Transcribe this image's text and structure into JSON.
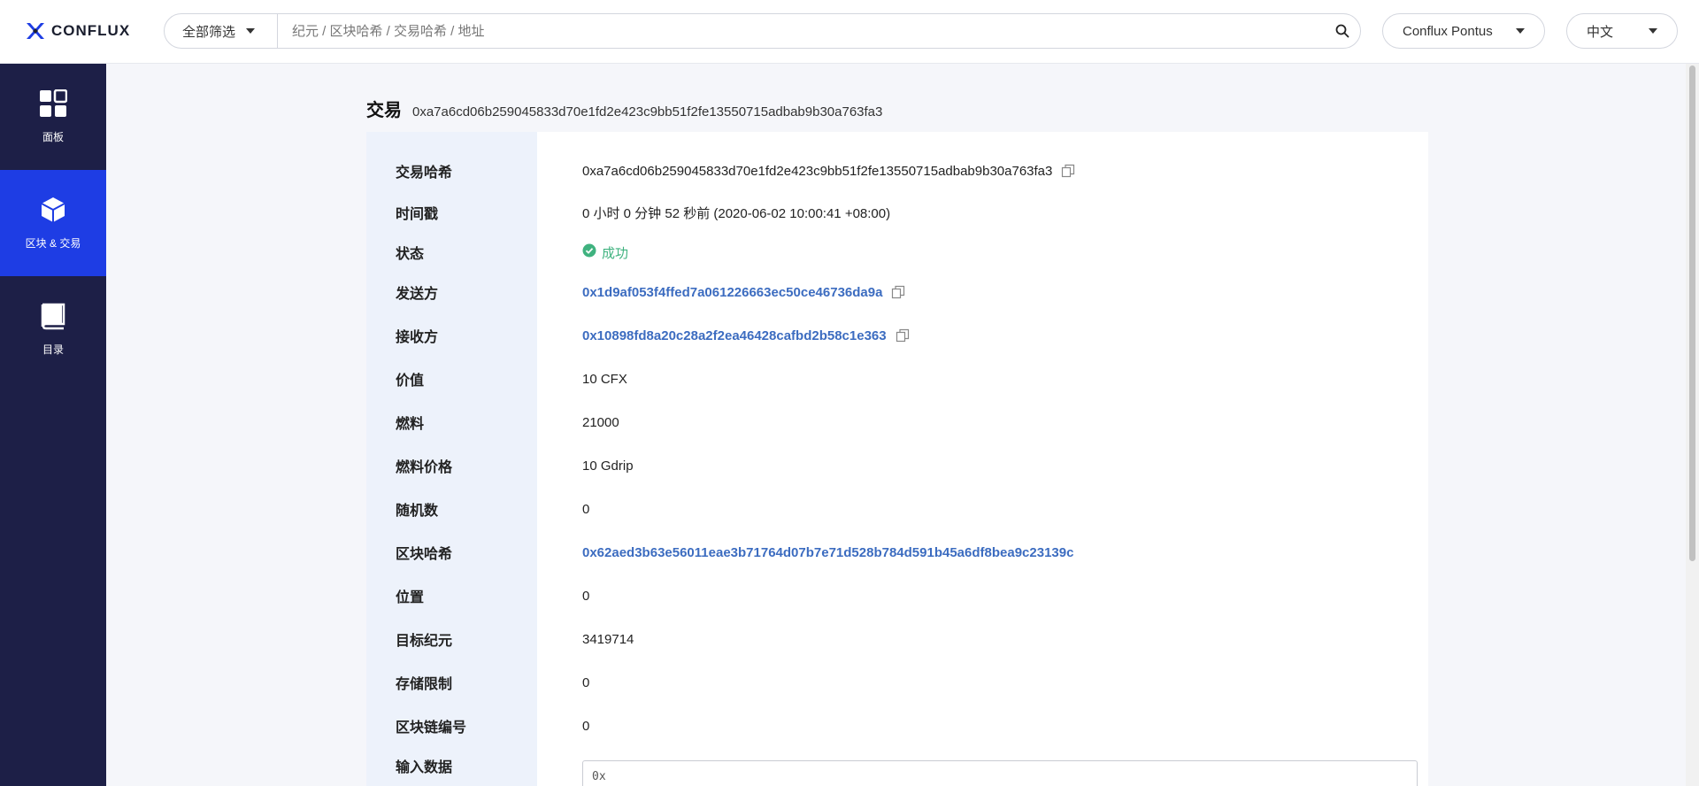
{
  "header": {
    "logo_text": "CONFLUX",
    "filter_label": "全部筛选",
    "search_placeholder": "纪元 / 区块哈希 / 交易哈希 / 地址",
    "network_label": "Conflux Pontus",
    "language_label": "中文"
  },
  "sidebar": {
    "items": [
      {
        "label": "面板",
        "icon": "dashboard-icon",
        "active": false
      },
      {
        "label": "区块 & 交易",
        "icon": "cube-icon",
        "active": true
      },
      {
        "label": "目录",
        "icon": "book-icon",
        "active": false
      }
    ]
  },
  "page": {
    "title": "交易",
    "hash": "0xa7a6cd06b259045833d70e1fd2e423c9bb51f2fe13550715adbab9b30a763fa3"
  },
  "details": {
    "tx_hash_label": "交易哈希",
    "tx_hash_value": "0xa7a6cd06b259045833d70e1fd2e423c9bb51f2fe13550715adbab9b30a763fa3",
    "timestamp_label": "时间戳",
    "timestamp_value": "0 小时 0 分钟 52 秒前  (2020-06-02 10:00:41 +08:00)",
    "status_label": "状态",
    "status_value": "成功",
    "from_label": "发送方",
    "from_value": "0x1d9af053f4ffed7a061226663ec50ce46736da9a",
    "to_label": "接收方",
    "to_value": "0x10898fd8a20c28a2f2ea46428cafbd2b58c1e363",
    "value_label": "价值",
    "value_value": "10 CFX",
    "gas_label": "燃料",
    "gas_value": "21000",
    "gas_price_label": "燃料价格",
    "gas_price_value": "10 Gdrip",
    "nonce_label": "随机数",
    "nonce_value": "0",
    "block_hash_label": "区块哈希",
    "block_hash_value": "0x62aed3b63e56011eae3b71764d07b7e71d528b784d591b45a6df8bea9c23139c",
    "position_label": "位置",
    "position_value": "0",
    "epoch_label": "目标纪元",
    "epoch_value": "3419714",
    "storage_label": "存储限制",
    "storage_value": "0",
    "chain_id_label": "区块链编号",
    "chain_id_value": "0",
    "input_label": "输入数据",
    "input_value": "0x"
  },
  "colors": {
    "sidebar_bg": "#1d1f47",
    "sidebar_active": "#1e3de4",
    "link": "#3c6cc0",
    "success": "#3fb27f"
  }
}
